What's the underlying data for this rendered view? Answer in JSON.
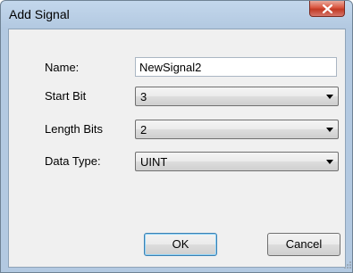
{
  "dialog": {
    "title": "Add Signal",
    "close_icon": "close-icon"
  },
  "form": {
    "name_label": "Name:",
    "name_value": "NewSignal2",
    "start_bit_label": "Start Bit",
    "start_bit_value": "3",
    "length_bits_label": "Length Bits",
    "length_bits_value": "2",
    "data_type_label": "Data Type:",
    "data_type_value": "UINT"
  },
  "buttons": {
    "ok_label": "OK",
    "cancel_label": "Cancel"
  },
  "colors": {
    "title_bar": "#b3c9e1",
    "close_button": "#c23a24",
    "client_background": "#f0f0f0",
    "ok_focus_border": "#3c7fb1"
  }
}
